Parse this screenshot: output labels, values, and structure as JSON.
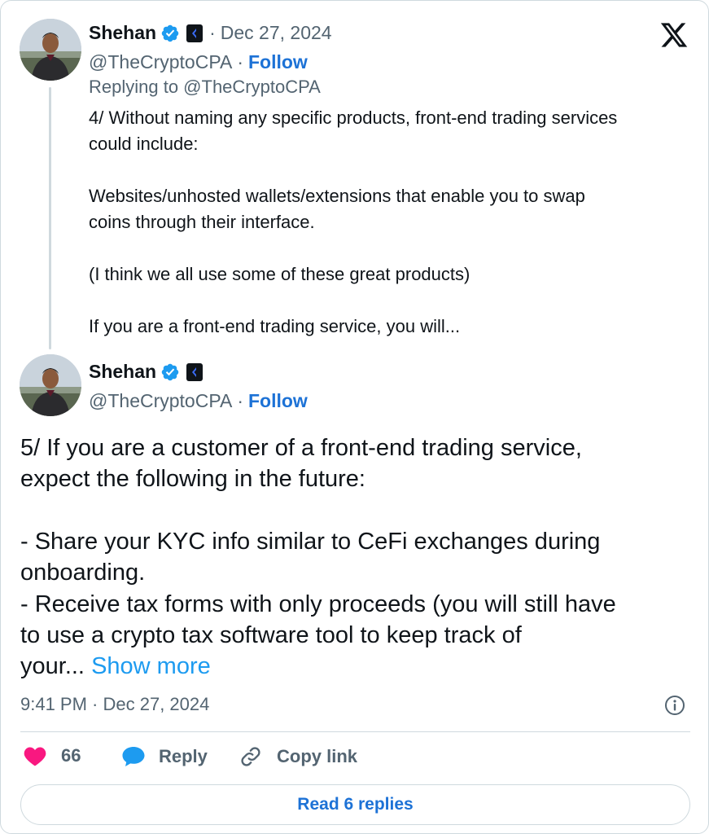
{
  "brand": {
    "icon": "x-logo-icon",
    "accent": "#1d9bf0"
  },
  "parent_tweet": {
    "author_name": "Shehan",
    "meta_sep": "·",
    "date": "Dec 27, 2024",
    "handle": "@TheCryptoCPA",
    "dot": "·",
    "follow_label": "Follow",
    "replying_to": "Replying to @TheCryptoCPA",
    "lines": [
      "4/ Without naming any specific products, front-end trading services",
      "could include:",
      "Websites/unhosted wallets/extensions that enable you to swap",
      "coins through their interface.",
      "(I think we all use some of these great products)",
      "If you are a front-end trading service, you will..."
    ]
  },
  "main_tweet": {
    "author_name": "Shehan",
    "handle": "@TheCryptoCPA",
    "dot": "·",
    "follow_label": "Follow",
    "lines": [
      "5/ If you are a customer of a front-end trading service,",
      "expect the following in the future:",
      "- Share your KYC info similar to CeFi exchanges during",
      "onboarding.",
      "- Receive tax forms with only proceeds (you will still have",
      "to use a crypto tax software tool to keep track of",
      "your..."
    ],
    "show_more_label": "Show more",
    "timestamp": "9:41 PM · Dec 27, 2024"
  },
  "actions": {
    "like_count": "66",
    "reply_label": "Reply",
    "copy_link_label": "Copy link",
    "like_color": "#f91880",
    "reply_color": "#1d9bf0"
  },
  "read_replies_label": "Read 6 replies"
}
